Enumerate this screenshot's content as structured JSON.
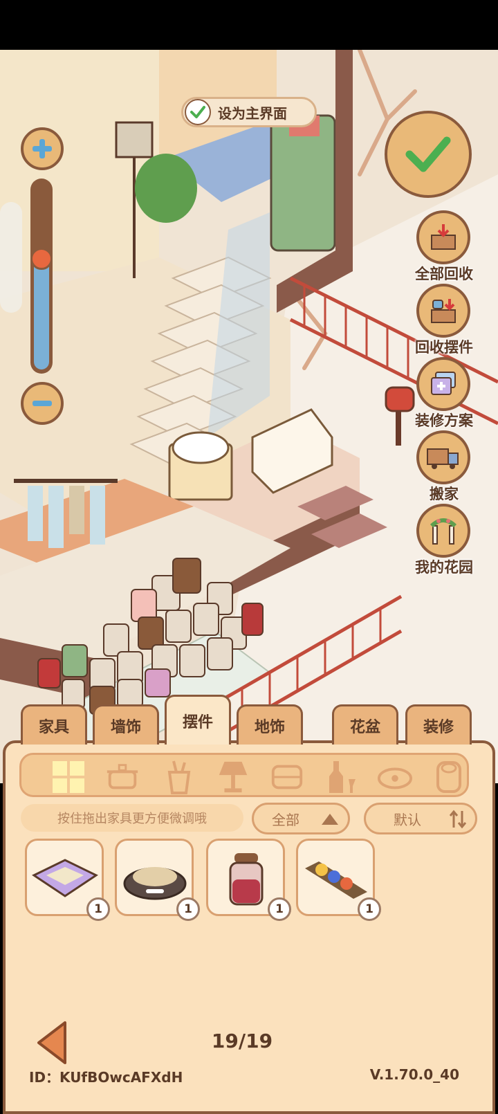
{
  "top_banner": {
    "set_main_label": "设为主界面"
  },
  "side_actions": [
    {
      "label": "全部回收",
      "icon": "box-down-icon"
    },
    {
      "label": "回收摆件",
      "icon": "cup-box-icon"
    },
    {
      "label": "装修方案",
      "icon": "plan-cards-icon"
    },
    {
      "label": "搬家",
      "icon": "moving-truck-icon"
    },
    {
      "label": "我的花园",
      "icon": "garden-arch-icon"
    }
  ],
  "tabs": [
    {
      "label": "家具",
      "active": false
    },
    {
      "label": "墙饰",
      "active": false
    },
    {
      "label": "摆件",
      "active": true
    },
    {
      "label": "地饰",
      "active": false
    },
    {
      "label": "花盆",
      "active": false
    },
    {
      "label": "装修",
      "active": false
    }
  ],
  "categories": [
    "grid-all-icon",
    "pot-icon",
    "toothbrush-cup-icon",
    "lamp-icon",
    "pillow-icon",
    "bottle-icon",
    "pet-bowl-icon",
    "paper-roll-icon"
  ],
  "hint": "按住拖出家具更方便微调哦",
  "filter": {
    "label": "全部"
  },
  "sort": {
    "label": "默认"
  },
  "items": [
    {
      "name": "pet-bed",
      "count": "1"
    },
    {
      "name": "pet-bowl",
      "count": "1"
    },
    {
      "name": "jam-jar",
      "count": "1"
    },
    {
      "name": "color-tray",
      "count": "1"
    }
  ],
  "pager": "19/19",
  "footer": {
    "id": "ID：KUfBOwcAFXdH",
    "version": "V.1.70.0_40"
  },
  "colors": {
    "accent_green": "#4caf50",
    "panel_bg": "#fbe1bd",
    "border_brown": "#8a5a3c"
  }
}
